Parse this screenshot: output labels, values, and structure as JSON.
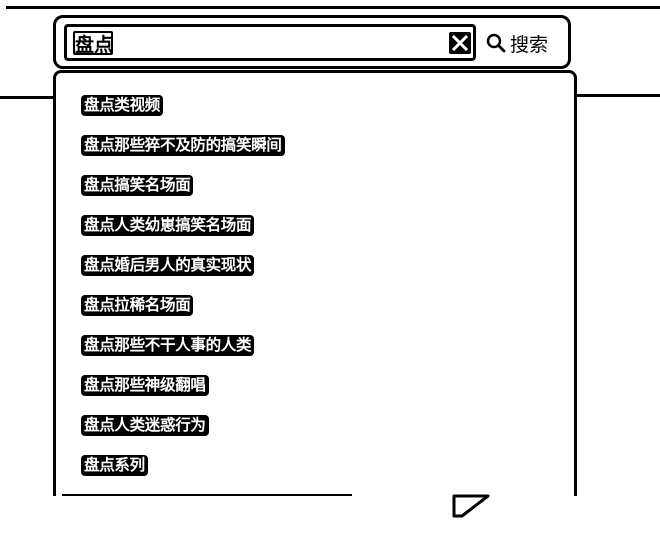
{
  "search": {
    "query": "盘点",
    "button_label": "搜索",
    "clear_icon": "close-icon",
    "search_icon": "magnifier-icon"
  },
  "suggestions": [
    "盘点类视频",
    "盘点那些猝不及防的搞笑瞬间",
    "盘点搞笑名场面",
    "盘点人类幼崽搞笑名场面",
    "盘点婚后男人的真实现状",
    "盘点拉稀名场面",
    "盘点那些不干人事的人类",
    "盘点那些神级翻唱",
    "盘点人类迷惑行为",
    "盘点系列"
  ],
  "colors": {
    "ink": "#000000",
    "paper": "#ffffff"
  }
}
